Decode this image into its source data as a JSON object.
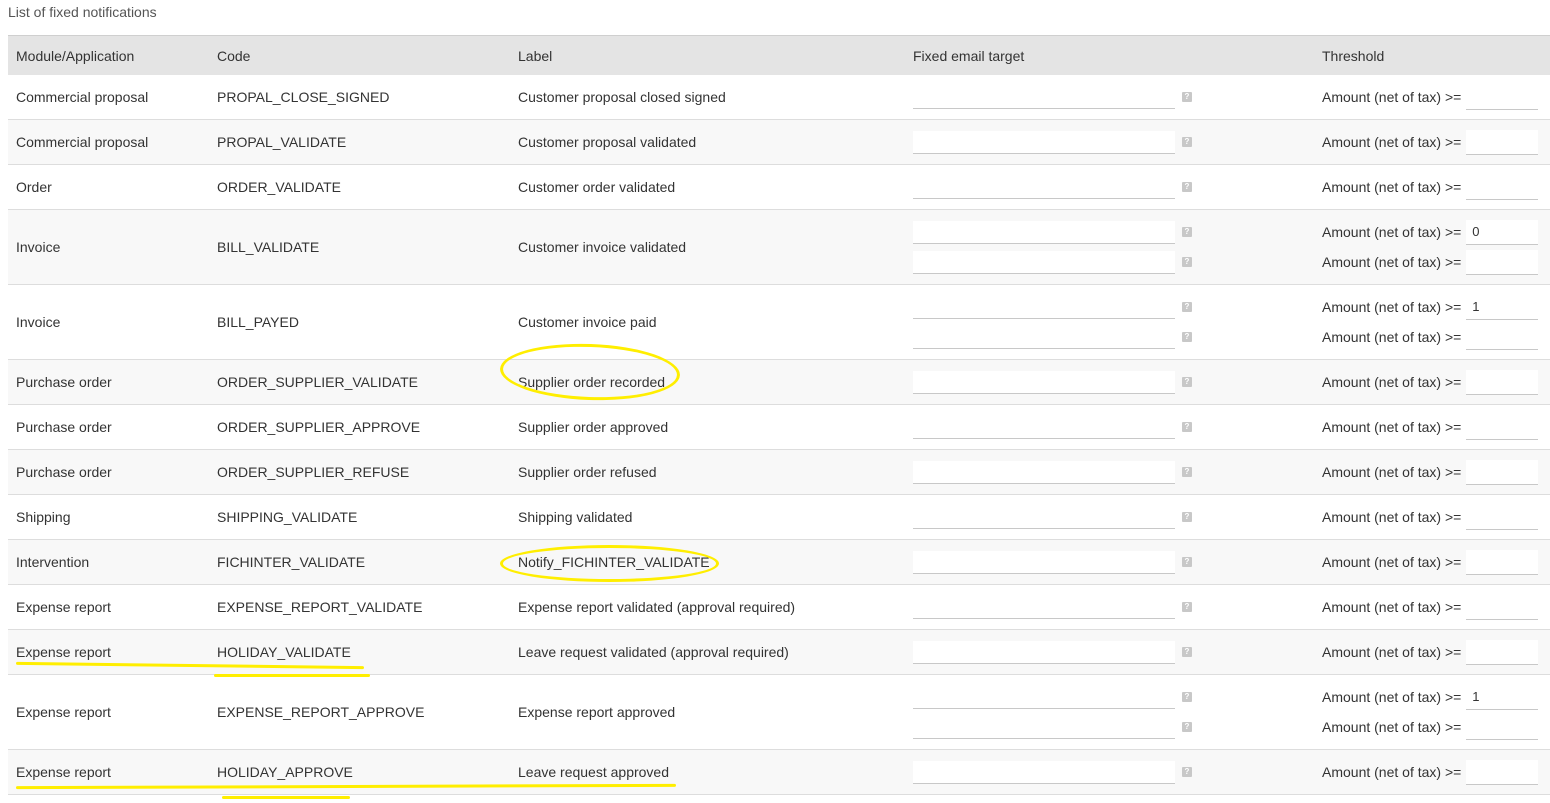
{
  "page": {
    "title": "List of fixed notifications"
  },
  "table": {
    "headers": {
      "module": "Module/Application",
      "code": "Code",
      "label": "Label",
      "email": "Fixed email target",
      "threshold": "Threshold"
    },
    "threshold_label": "Amount (net of tax) >=",
    "help_icon": "?",
    "rows": [
      {
        "module": "Commercial proposal",
        "code": "PROPAL_CLOSE_SIGNED",
        "label": "Customer proposal closed signed",
        "thresholds": [
          ""
        ]
      },
      {
        "module": "Commercial proposal",
        "code": "PROPAL_VALIDATE",
        "label": "Customer proposal validated",
        "thresholds": [
          ""
        ]
      },
      {
        "module": "Order",
        "code": "ORDER_VALIDATE",
        "label": "Customer order validated",
        "thresholds": [
          ""
        ]
      },
      {
        "module": "Invoice",
        "code": "BILL_VALIDATE",
        "label": "Customer invoice validated",
        "thresholds": [
          "0",
          ""
        ]
      },
      {
        "module": "Invoice",
        "code": "BILL_PAYED",
        "label": "Customer invoice paid",
        "thresholds": [
          "1",
          ""
        ]
      },
      {
        "module": "Purchase order",
        "code": "ORDER_SUPPLIER_VALIDATE",
        "label": "Supplier order recorded",
        "thresholds": [
          ""
        ]
      },
      {
        "module": "Purchase order",
        "code": "ORDER_SUPPLIER_APPROVE",
        "label": "Supplier order approved",
        "thresholds": [
          ""
        ]
      },
      {
        "module": "Purchase order",
        "code": "ORDER_SUPPLIER_REFUSE",
        "label": "Supplier order refused",
        "thresholds": [
          ""
        ]
      },
      {
        "module": "Shipping",
        "code": "SHIPPING_VALIDATE",
        "label": "Shipping validated",
        "thresholds": [
          ""
        ]
      },
      {
        "module": "Intervention",
        "code": "FICHINTER_VALIDATE",
        "label": "Notify_FICHINTER_VALIDATE",
        "thresholds": [
          ""
        ]
      },
      {
        "module": "Expense report",
        "code": "EXPENSE_REPORT_VALIDATE",
        "label": "Expense report validated (approval required)",
        "thresholds": [
          ""
        ]
      },
      {
        "module": "Expense report",
        "code": "HOLIDAY_VALIDATE",
        "label": "Leave request validated (approval required)",
        "thresholds": [
          ""
        ]
      },
      {
        "module": "Expense report",
        "code": "EXPENSE_REPORT_APPROVE",
        "label": "Expense report approved",
        "thresholds": [
          "1",
          ""
        ]
      },
      {
        "module": "Expense report",
        "code": "HOLIDAY_APPROVE",
        "label": "Leave request approved",
        "thresholds": [
          ""
        ]
      }
    ]
  },
  "annotations": {
    "highlight_color": "#ffee00"
  }
}
